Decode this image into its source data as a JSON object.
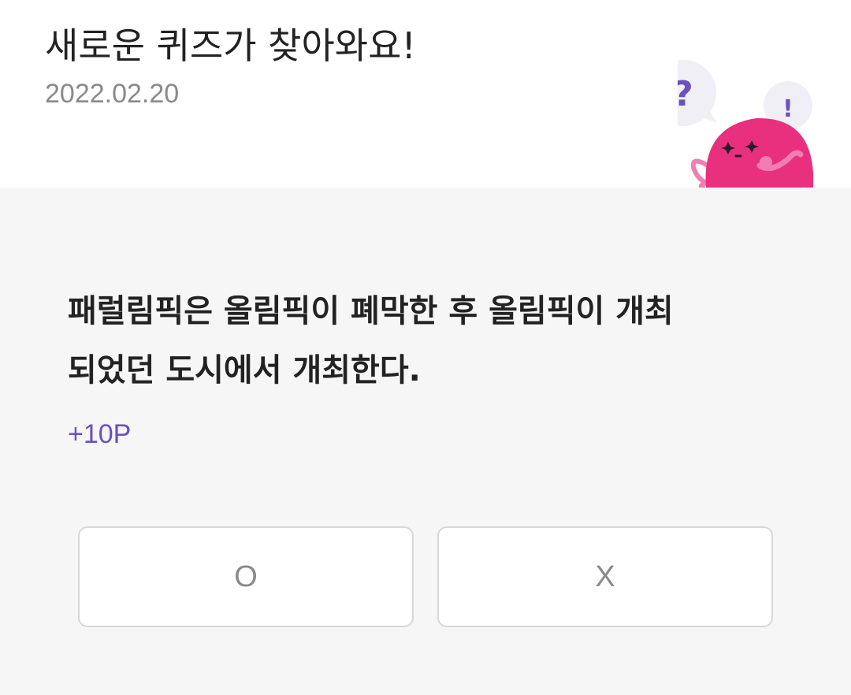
{
  "header": {
    "title": "새로운 퀴즈가 찾아와요!",
    "date": "2022.02.20"
  },
  "mascot": {
    "bubble_left_glyph": "?",
    "bubble_right_glyph": "!",
    "body_color": "#e8307f",
    "accent_color": "#6c4fc0"
  },
  "quiz": {
    "question": "패럴림픽은 올림픽이 폐막한 후 올림픽이 개최\n되었던 도시에서 개최한다.",
    "points": "+10P",
    "answer_o": "O",
    "answer_x": "X"
  },
  "colors": {
    "accent": "#6c4fc0",
    "background": "#f6f6f6"
  }
}
